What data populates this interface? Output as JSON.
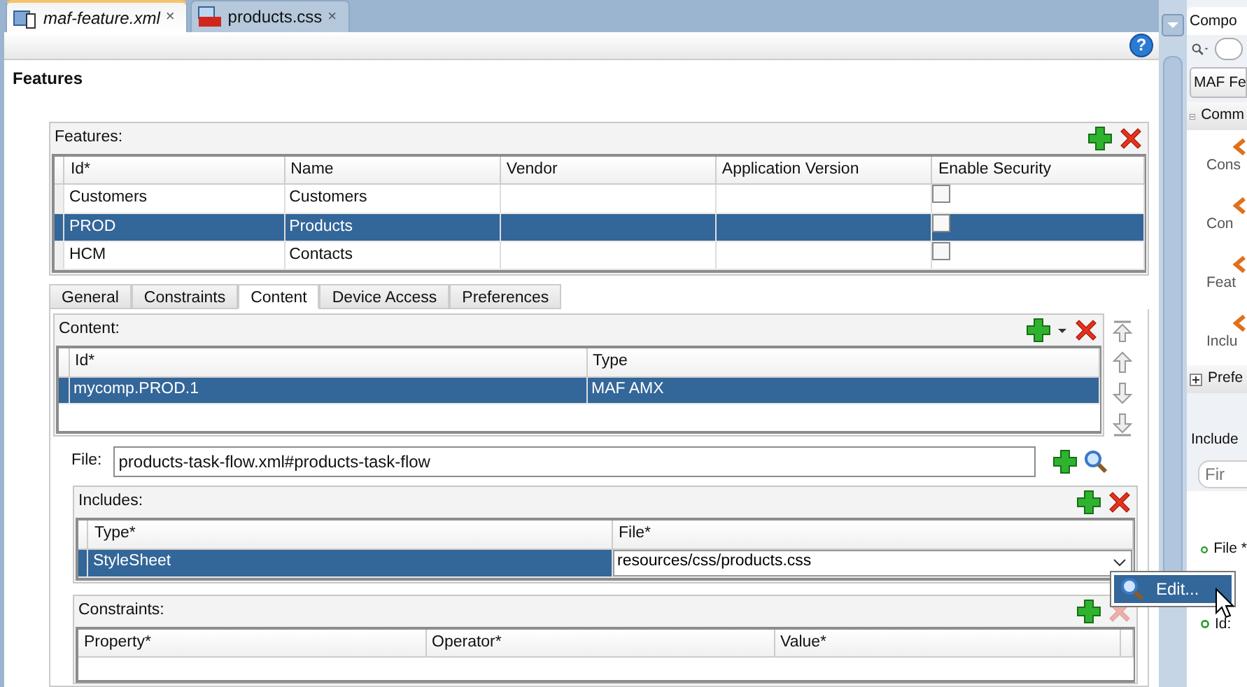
{
  "editor_tabs": [
    {
      "label": "maf-feature.xml",
      "selected": true,
      "kind": "xml",
      "close": "×"
    },
    {
      "label": "products.css",
      "selected": false,
      "kind": "css",
      "close": "×"
    }
  ],
  "help_button": "?",
  "page_title": "Features",
  "features": {
    "title": "Features:",
    "columns": [
      "Id*",
      "Name",
      "Vendor",
      "Application Version",
      "Enable Security"
    ],
    "rows": [
      {
        "id": "Customers",
        "name": "Customers",
        "enable_security": false,
        "selected": false
      },
      {
        "id": "PROD",
        "name": "Products",
        "enable_security": false,
        "selected": true
      },
      {
        "id": "HCM",
        "name": "Contacts",
        "enable_security": false,
        "selected": false
      }
    ]
  },
  "detail_tabs": [
    {
      "label": "General",
      "selected": false
    },
    {
      "label": "Constraints",
      "selected": false
    },
    {
      "label": "Content",
      "selected": true
    },
    {
      "label": "Device Access",
      "selected": false
    },
    {
      "label": "Preferences",
      "selected": false
    }
  ],
  "content": {
    "title": "Content:",
    "columns": [
      "Id*",
      "Type"
    ],
    "rows": [
      {
        "id": "mycomp.PROD.1",
        "type": "MAF AMX",
        "selected": true
      }
    ]
  },
  "file": {
    "label": "File:",
    "value": "products-task-flow.xml#products-task-flow"
  },
  "includes": {
    "title": "Includes:",
    "columns": [
      "Type*",
      "File*"
    ],
    "rows": [
      {
        "type": "StyleSheet",
        "file": "resources/css/products.css",
        "selected": true
      }
    ]
  },
  "popup_menu": [
    {
      "label": "Edit...",
      "selected": true
    }
  ],
  "constraints": {
    "title": "Constraints:",
    "columns": [
      "Property*",
      "Operator*",
      "Value*"
    ]
  },
  "side_panel": {
    "tab": "Compo",
    "filter": "MAF Fe",
    "sections": [
      {
        "label": "Comm",
        "expanded": true,
        "items": [
          "Cons",
          "Con",
          "Feat",
          "Inclu"
        ]
      },
      {
        "label": "Prefe",
        "expanded": false
      }
    ],
    "properties_title": "Include",
    "search_placeholder": "Fir",
    "properties": [
      "File *",
      "Id:"
    ]
  }
}
